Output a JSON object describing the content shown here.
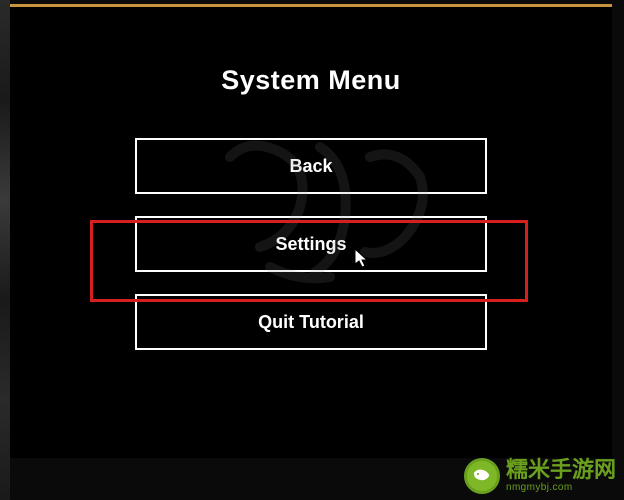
{
  "menu": {
    "title": "System Menu",
    "back_label": "Back",
    "settings_label": "Settings",
    "quit_label": "Quit Tutorial"
  },
  "watermark": {
    "site_name_cn": "糯米手游网",
    "site_url": "nmgmybj.com"
  }
}
